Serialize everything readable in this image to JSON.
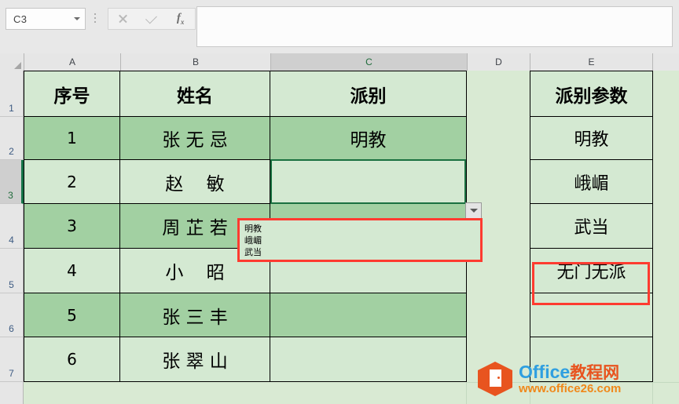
{
  "app": {
    "namebox_value": "C3",
    "formula_value": "",
    "icons": {
      "namebox_dropdown": "chevron-down-icon",
      "cancel": "x-icon",
      "confirm": "check-icon",
      "function": "fx-icon",
      "menu_dots": "vertical-dots-icon",
      "select_all": "select-all-triangle-icon"
    }
  },
  "grid": {
    "column_headers": [
      "A",
      "B",
      "C",
      "D",
      "E"
    ],
    "row_headers": [
      "1",
      "2",
      "3",
      "4",
      "5",
      "6",
      "7"
    ],
    "selected_column": "C",
    "selected_row": "3",
    "active_cell": "C3"
  },
  "table": {
    "headers": {
      "a": "序号",
      "b": "姓名",
      "c": "派别",
      "e": "派别参数"
    },
    "rows": [
      {
        "no": "1",
        "name": "张 无 忌",
        "sect": "明教",
        "param": "明教"
      },
      {
        "no": "2",
        "name": "赵    敏",
        "sect": "",
        "param": "峨嵋"
      },
      {
        "no": "3",
        "name": "周 芷 若",
        "sect": "",
        "param": "武当"
      },
      {
        "no": "4",
        "name": "小    昭",
        "sect": "",
        "param": "无门无派"
      },
      {
        "no": "5",
        "name": "张 三 丰",
        "sect": "",
        "param": ""
      },
      {
        "no": "6",
        "name": "张 翠 山",
        "sect": "",
        "param": ""
      }
    ]
  },
  "validation": {
    "dropdown_button_icon": "dropdown-arrow-icon",
    "options": [
      "明教",
      "峨嵋",
      "武当"
    ]
  },
  "annotations": {
    "list_box_color": "#ff3b30",
    "cell_box_color": "#ff3b30",
    "highlighted_param": "无门无派"
  },
  "watermark": {
    "brand_en": "Office",
    "brand_cn": "教程网",
    "url": "www.office26.com",
    "logo_icon": "office-hexagon-icon"
  },
  "colors": {
    "band_light": "#d4e9d2",
    "band_dark": "#a2d0a2",
    "selection_green": "#1a7040",
    "header_gray": "#e6e6e6"
  }
}
